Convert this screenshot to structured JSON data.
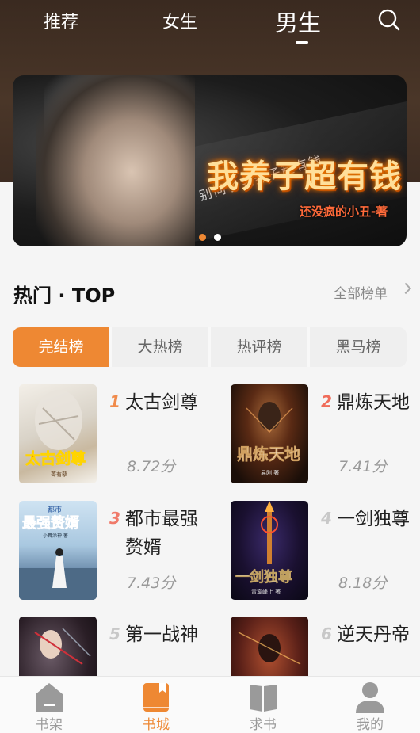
{
  "top_tabs": [
    "推荐",
    "女生",
    "男生"
  ],
  "banner": {
    "subtitle": "别问了我养子超有钱",
    "title": "我养子超有钱",
    "author": "还没疯的小丑-著"
  },
  "section": {
    "title": "热门 · TOP",
    "all_lists": "全部榜单"
  },
  "rank_tabs": [
    "完结榜",
    "大热榜",
    "热评榜",
    "黑马榜"
  ],
  "books": [
    {
      "rank": "1",
      "title": "太古剑尊",
      "score": "8.72分"
    },
    {
      "rank": "2",
      "title": "鼎炼天地",
      "score": "7.41分"
    },
    {
      "rank": "3",
      "title": "都市最强赘婿",
      "score": "7.43分"
    },
    {
      "rank": "4",
      "title": "一剑独尊",
      "score": "8.18分"
    },
    {
      "rank": "5",
      "title": "第一战神",
      "score": ""
    },
    {
      "rank": "6",
      "title": "逆天丹帝",
      "score": ""
    }
  ],
  "covers": [
    {
      "title": "太古剑尊",
      "author": "菁有孽"
    },
    {
      "title": "鼎炼天地",
      "author": "易刚 著"
    },
    {
      "title": "最强赘婿",
      "tag": "都市",
      "author": "小舞涂神 著"
    },
    {
      "title": "一剑独尊",
      "author": "青鸾峰上 著"
    },
    {
      "title": "",
      "author": ""
    },
    {
      "title": "",
      "author": ""
    }
  ],
  "bottom_nav": [
    "书架",
    "书城",
    "求书",
    "我的"
  ],
  "colors": {
    "accent": "#ee8833",
    "rank_top3": "#f06c5a",
    "rank_rest": "#c8c8c8"
  }
}
